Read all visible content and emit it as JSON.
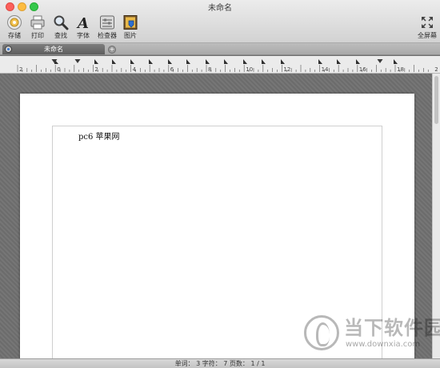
{
  "window": {
    "title": "未命名"
  },
  "toolbar": {
    "items": [
      {
        "label": "存储",
        "icon": "save-icon"
      },
      {
        "label": "打印",
        "icon": "print-icon"
      },
      {
        "label": "查找",
        "icon": "search-icon"
      },
      {
        "label": "字体",
        "icon": "font-icon"
      },
      {
        "label": "检查器",
        "icon": "inspector-icon"
      },
      {
        "label": "图片",
        "icon": "picture-icon"
      }
    ],
    "fullscreen_label": "全屏幕"
  },
  "tabs": [
    {
      "label": "未命名",
      "active": true
    }
  ],
  "ruler": {
    "labels": [
      "2",
      "0",
      "2",
      "4",
      "6",
      "8",
      "10",
      "12",
      "14",
      "16",
      "18",
      "2"
    ]
  },
  "document": {
    "text": "pc6 苹果网"
  },
  "statusbar": {
    "text": "单词： 3 字符： 7 页数： 1 / 1"
  },
  "watermark": {
    "brand": "当下软件园",
    "url": "www.downxia.com"
  },
  "colors": {
    "close": "#fc605c",
    "minimize": "#fdbc40",
    "zoom": "#34c84a",
    "accent": "#3b7bd6"
  }
}
